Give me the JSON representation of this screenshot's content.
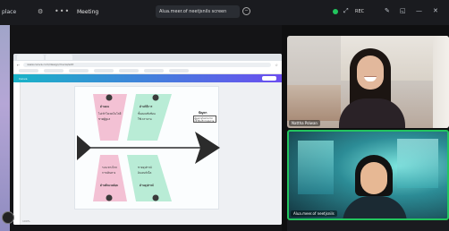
{
  "topbar": {
    "app_label": "place",
    "meeting_label": "Meeting",
    "share_title": "Alua.meer.of neetjsnils screen",
    "rec_label": "REC"
  },
  "browser": {
    "url": "www.canva.com/design/mural/edit",
    "toolbar_left": "Canva",
    "zoom_label": "100%"
  },
  "diagram": {
    "head_title": "ปัญหา",
    "head_text": "ผู้สูงอายุไม่สามารถเข้าถึงบริการสุขภาพ",
    "top_left_title": "ด้านคน",
    "top_left_items": [
      "ไม่เข้าใจเทคโนโลยี",
      "ขาดผู้ดูแล"
    ],
    "top_right_title": "ด้านวิธีการ",
    "top_right_items": [
      "ขั้นตอนซับซ้อน",
      "ใช้เวลานาน"
    ],
    "bottom_left_title": "ด้านสิ่งแวดล้อม",
    "bottom_left_items": [
      "ระยะทางไกล",
      "การเดินทาง"
    ],
    "bottom_right_title": "ด้านอุปกรณ์",
    "bottom_right_items": [
      "ขาดอุปกรณ์",
      "อินเทอร์เน็ต"
    ]
  },
  "participants": [
    {
      "name": "Nattha Polwan"
    },
    {
      "name": "Alua.meer.of neetjsnils"
    }
  ],
  "colors": {
    "accent_green": "#22c55e",
    "pink_bone": "#f3c1d4",
    "green_bone": "#b9ecd6",
    "fish_black": "#2b2b2b"
  }
}
